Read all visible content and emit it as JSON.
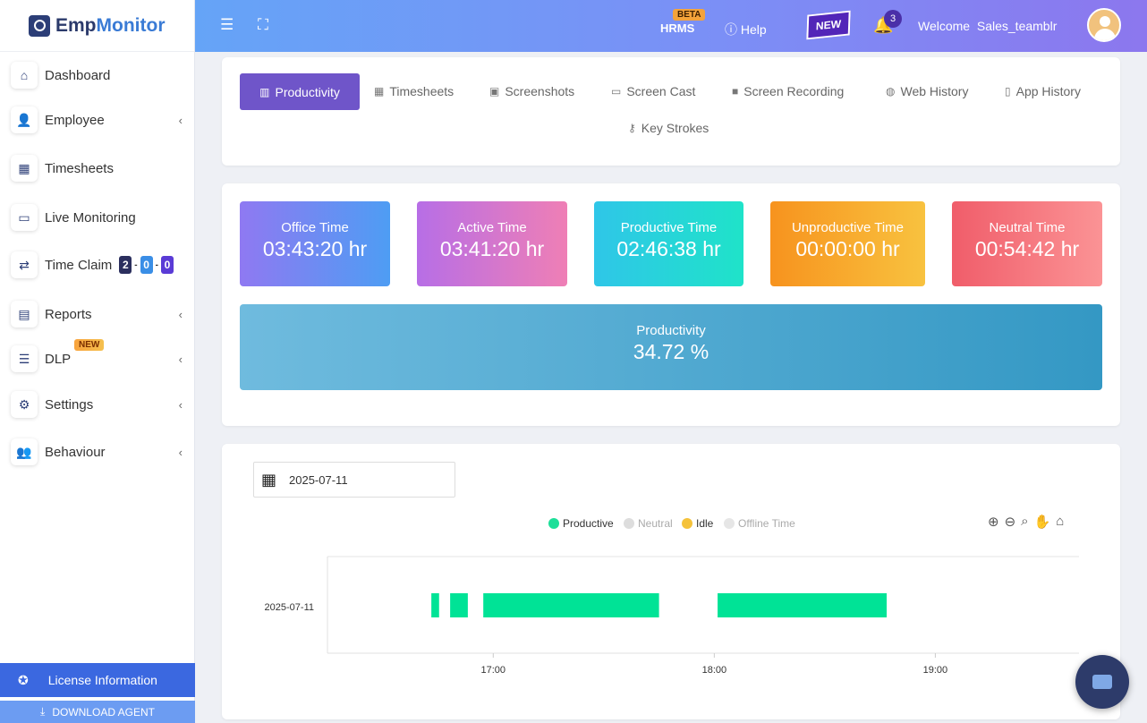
{
  "brand": {
    "prefix": "Emp",
    "suffix": "Monitor"
  },
  "sidebar": {
    "items": [
      {
        "label": "Dashboard",
        "icon": "home-icon",
        "glyph": "⌂",
        "chevron": ""
      },
      {
        "label": "Employee",
        "icon": "user-icon",
        "glyph": "👤",
        "chevron": "‹"
      },
      {
        "label": "Timesheets",
        "icon": "calendar-icon",
        "glyph": "▦",
        "chevron": ""
      },
      {
        "label": "Live Monitoring",
        "icon": "live-icon",
        "glyph": "▭",
        "chevron": ""
      },
      {
        "label": "Time Claim",
        "icon": "swap-icon",
        "glyph": "⇄",
        "chevron": ""
      },
      {
        "label": "Reports",
        "icon": "report-icon",
        "glyph": "▤",
        "chevron": "‹"
      },
      {
        "label": "DLP",
        "icon": "sliders-icon",
        "glyph": "☰",
        "chevron": "‹"
      },
      {
        "label": "Settings",
        "icon": "gear-icon",
        "glyph": "⚙",
        "chevron": "‹"
      },
      {
        "label": "Behaviour",
        "icon": "user-settings-icon",
        "glyph": "👥",
        "chevron": "‹"
      }
    ],
    "dlp_badge": "NEW",
    "time_claim_counts": [
      "2",
      "0",
      "0"
    ],
    "time_claim_colors": [
      "#2b2f5e",
      "#3a8ee6",
      "#5a3bd6"
    ],
    "license_label": "License Information",
    "download_label": "DOWNLOAD AGENT"
  },
  "header": {
    "hrms": "HRMS",
    "beta": "BETA",
    "help": "Help",
    "new_flag": "NEW",
    "notifications": "3",
    "welcome": "Welcome",
    "username": "Sales_teamblr"
  },
  "tabs": [
    {
      "label": "Productivity",
      "glyph": "▥"
    },
    {
      "label": "Timesheets",
      "glyph": "▦"
    },
    {
      "label": "Screenshots",
      "glyph": "▣"
    },
    {
      "label": "Screen Cast",
      "glyph": "▭"
    },
    {
      "label": "Screen Recording",
      "glyph": "■"
    },
    {
      "label": "Web History",
      "glyph": "◍"
    },
    {
      "label": "App History",
      "glyph": "▯"
    },
    {
      "label": "Key Strokes",
      "glyph": "⚷"
    }
  ],
  "stats": [
    {
      "label": "Office Time",
      "value": "03:43:20 hr",
      "colors": [
        "#8f79f2",
        "#4e9df3"
      ]
    },
    {
      "label": "Active Time",
      "value": "03:41:20 hr",
      "colors": [
        "#b76ee6",
        "#ef7fb5"
      ]
    },
    {
      "label": "Productive Time",
      "value": "02:46:38 hr",
      "colors": [
        "#2fc6e8",
        "#1fe3c9"
      ]
    },
    {
      "label": "Unproductive Time",
      "value": "00:00:00 hr",
      "colors": [
        "#f7931e",
        "#f8c23f"
      ]
    },
    {
      "label": "Neutral Time",
      "value": "00:54:42 hr",
      "colors": [
        "#f05d6a",
        "#fb9395"
      ]
    }
  ],
  "productivity": {
    "label": "Productivity",
    "value": "34.72 %"
  },
  "timeline": {
    "date": "2025-07-11",
    "legend": [
      {
        "label": "Productive",
        "color": "#1ddf99",
        "active": true
      },
      {
        "label": "Neutral",
        "color": "#dddddd",
        "active": false
      },
      {
        "label": "Idle",
        "color": "#f5c23a",
        "active": true
      },
      {
        "label": "Offline Time",
        "color": "#e6e6e6",
        "active": false
      }
    ],
    "row_label": "2025-07-11",
    "ticks": [
      "17:00",
      "18:00",
      "19:00"
    ],
    "tick_hours": [
      17,
      18,
      19
    ],
    "x_range_hours": [
      16.25,
      19.65
    ],
    "segments_hours": [
      [
        16.72,
        16.755
      ],
      [
        16.805,
        16.885
      ],
      [
        16.955,
        17.75
      ],
      [
        18.015,
        18.78
      ]
    ],
    "segment_color": "#00e396"
  }
}
